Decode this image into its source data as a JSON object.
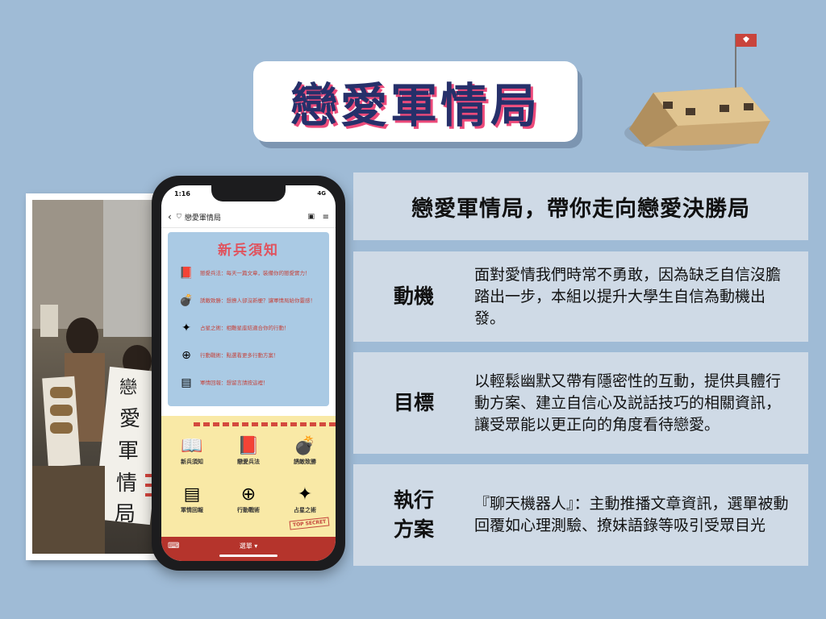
{
  "slide": {
    "title": "戀愛軍情局",
    "headline": "戀愛軍情局，帶你走向戀愛決勝局",
    "rows": [
      {
        "label": "動機",
        "text": "面對愛情我們時常不勇敢，因為缺乏自信沒膽踏出一步，本組以提升大學生自信為動機出發。"
      },
      {
        "label": "目標",
        "text": "以輕鬆幽默又帶有隱密性的互動，提供具體行動方案、建立自信心及説話技巧的相關資訊，讓受眾能以更正向的角度看待戀愛。"
      },
      {
        "label_line1": "執行",
        "label_line2": "方案",
        "text": "『聊天機器人』：主動推播文章資訊，選單被動回覆如心理測驗、撩妹語錄等吸引受眾目光"
      }
    ]
  },
  "phone": {
    "status_time": "1:16",
    "status_right": "4G",
    "chat_name": "戀愛軍情局",
    "card_title": "新兵須知",
    "card_rows": [
      {
        "icon": "book-icon",
        "glyph": "📕",
        "text": "戀愛兵法：每天一篇文章，裝備你的戀愛實力！"
      },
      {
        "icon": "bomb-icon",
        "glyph": "💣",
        "text": "誘敵致勝：想撩人卻沒新梗？讓軍情局給你靈感！"
      },
      {
        "icon": "star-icon",
        "glyph": "✦",
        "text": "占星之術：相難星座結適合你的行動！"
      },
      {
        "icon": "crosshair-icon",
        "glyph": "⊕",
        "text": "行動戰術：點選看更多行動方案！"
      },
      {
        "icon": "report-icon",
        "glyph": "▤",
        "text": "軍情回報：想留言請按這裡！"
      }
    ],
    "menu_items": [
      {
        "icon": "notebook-icon",
        "glyph": "📖",
        "label": "新兵須知"
      },
      {
        "icon": "book-icon",
        "glyph": "📕",
        "label": "戀愛兵法"
      },
      {
        "icon": "bomb-icon",
        "glyph": "💣",
        "label": "誘敵致勝"
      },
      {
        "icon": "report-icon",
        "glyph": "▤",
        "label": "軍情回報"
      },
      {
        "icon": "crosshair-icon",
        "glyph": "⊕",
        "label": "行動戰術"
      },
      {
        "icon": "star-icon",
        "glyph": "✦",
        "label": "占星之術"
      }
    ],
    "stamp": "TOP SECRET",
    "bottom_label": "選單 ▾"
  },
  "colors": {
    "background": "#9fbbd6",
    "panel": "#cfdae6",
    "title_text": "#26306a",
    "title_shadow": "#ec4a7a",
    "phone_card": "#aacae4",
    "phone_menu": "#f9e9a6",
    "phone_bar": "#b5342c"
  }
}
